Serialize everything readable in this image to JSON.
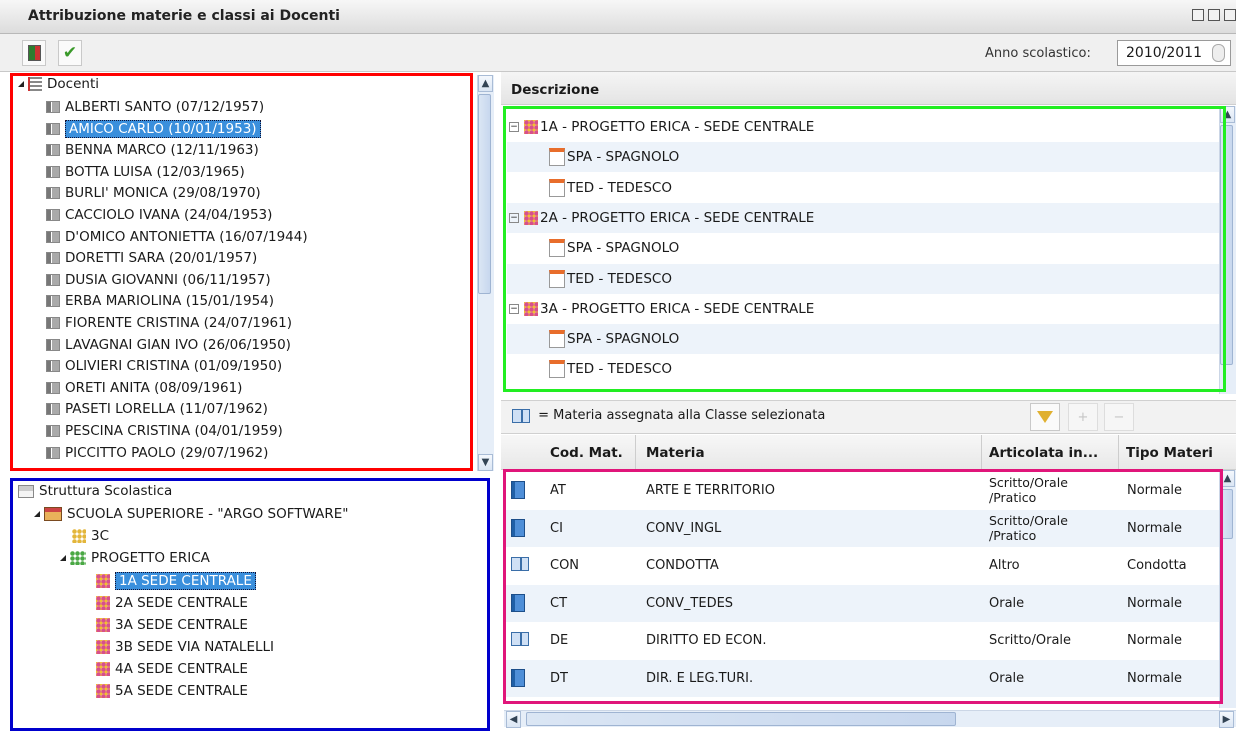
{
  "window": {
    "title": "Attribuzione materie e classi ai Docenti",
    "anno_label": "Anno scolastico:",
    "anno_value": "2010/2011"
  },
  "docenti": {
    "root": "Docenti",
    "items": [
      "ALBERTI SANTO (07/12/1957)",
      "AMICO CARLO (10/01/1953)",
      "BENNA MARCO (12/11/1963)",
      "BOTTA LUISA (12/03/1965)",
      "BURLI' MONICA (29/08/1970)",
      "CACCIOLO IVANA (24/04/1953)",
      "D'OMICO ANTONIETTA (16/07/1944)",
      "DORETTI SARA (20/01/1957)",
      "DUSIA GIOVANNI (06/11/1957)",
      "ERBA MARIOLINA (15/01/1954)",
      "FIORENTE CRISTINA (24/07/1961)",
      "LAVAGNAI GIAN IVO (26/06/1950)",
      "OLIVIERI CRISTINA (01/09/1950)",
      "ORETI ANITA (08/09/1961)",
      "PASETI LORELLA (11/07/1962)",
      "PESCINA CRISTINA (04/01/1959)",
      "PICCITTO PAOLO (29/07/1962)"
    ],
    "selected_index": 1
  },
  "struttura": {
    "root": "Struttura Scolastica",
    "school": "SCUOLA SUPERIORE - \"ARGO SOFTWARE\"",
    "class_3c": "3C",
    "progetto": "PROGETTO ERICA",
    "classes": [
      "1A SEDE CENTRALE",
      "2A SEDE CENTRALE",
      "3A SEDE CENTRALE",
      "3B SEDE VIA NATALELLI",
      "4A SEDE CENTRALE",
      "5A SEDE CENTRALE"
    ],
    "selected_index": 0
  },
  "descrizione": {
    "header": "Descrizione",
    "groups": [
      {
        "label": "1A - PROGETTO ERICA - SEDE CENTRALE",
        "materie": [
          "SPA - SPAGNOLO",
          "TED - TEDESCO"
        ]
      },
      {
        "label": "2A - PROGETTO ERICA - SEDE CENTRALE",
        "materie": [
          "SPA - SPAGNOLO",
          "TED - TEDESCO"
        ]
      },
      {
        "label": "3A - PROGETTO ERICA - SEDE CENTRALE",
        "materie": [
          "SPA - SPAGNOLO",
          "TED - TEDESCO"
        ]
      }
    ]
  },
  "legend": {
    "text": "= Materia assegnata alla Classe selezionata"
  },
  "grid": {
    "columns": [
      "Cod. Mat.",
      "Materia",
      "Articolata in...",
      "Tipo Materi"
    ],
    "rows": [
      {
        "icon": "binder-icon",
        "cod": "AT",
        "materia": "ARTE E TERRITORIO",
        "articolata": "Scritto/Orale /Pratico",
        "tipo": "Normale"
      },
      {
        "icon": "binder-icon",
        "cod": "CI",
        "materia": "CONV_INGL",
        "articolata": "Scritto/Orale /Pratico",
        "tipo": "Normale"
      },
      {
        "icon": "book-icon",
        "cod": "CON",
        "materia": "CONDOTTA",
        "articolata": "Altro",
        "tipo": "Condotta"
      },
      {
        "icon": "binder-icon",
        "cod": "CT",
        "materia": "CONV_TEDES",
        "articolata": "Orale",
        "tipo": "Normale"
      },
      {
        "icon": "book-icon",
        "cod": "DE",
        "materia": "DIRITTO ED ECON.",
        "articolata": "Scritto/Orale",
        "tipo": "Normale"
      },
      {
        "icon": "binder-icon",
        "cod": "DT",
        "materia": "DIR. E LEG.TURI.",
        "articolata": "Orale",
        "tipo": "Normale"
      }
    ]
  },
  "colors": {
    "outline_docenti": "#ff0000",
    "outline_struttura": "#0000cc",
    "outline_descrizione": "#22ee22",
    "outline_grid": "#e0157a",
    "selection": "#3a8fdc"
  }
}
